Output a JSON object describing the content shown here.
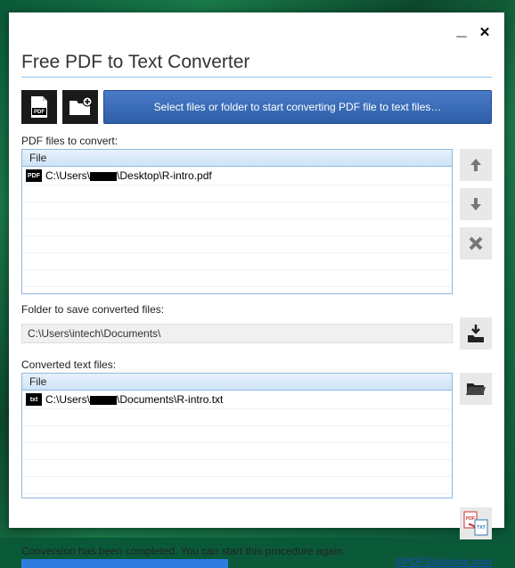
{
  "window": {
    "title": "Free PDF to Text Converter"
  },
  "toolbar": {
    "add_pdf_tooltip": "Add PDF file",
    "add_folder_tooltip": "Add folder",
    "main_action_label": "Select files or folder to start converting PDF file to text files…"
  },
  "pdf_section": {
    "label": "PDF files to convert:",
    "column_header": "File",
    "rows": [
      {
        "icon": "PDF",
        "prefix": "C:\\Users\\",
        "redacted": true,
        "suffix": "\\Desktop\\R-intro.pdf"
      }
    ]
  },
  "folder_section": {
    "label": "Folder to save converted files:",
    "path": "C:\\Users\\intech\\Documents\\"
  },
  "converted_section": {
    "label": "Converted text files:",
    "column_header": "File",
    "rows": [
      {
        "icon": "txt",
        "prefix": "C:\\Users\\",
        "redacted": true,
        "suffix": "\\Documents\\R-intro.txt"
      }
    ]
  },
  "side_buttons": {
    "move_up": "▲",
    "move_down": "▼",
    "remove": "✕",
    "browse_save": "⬇",
    "open_converted": "📂"
  },
  "footer": {
    "status": "Conversion has been completed. You can start this procedure again.",
    "progress_percent": 100,
    "link_text": "©PDFSolutions.com"
  }
}
